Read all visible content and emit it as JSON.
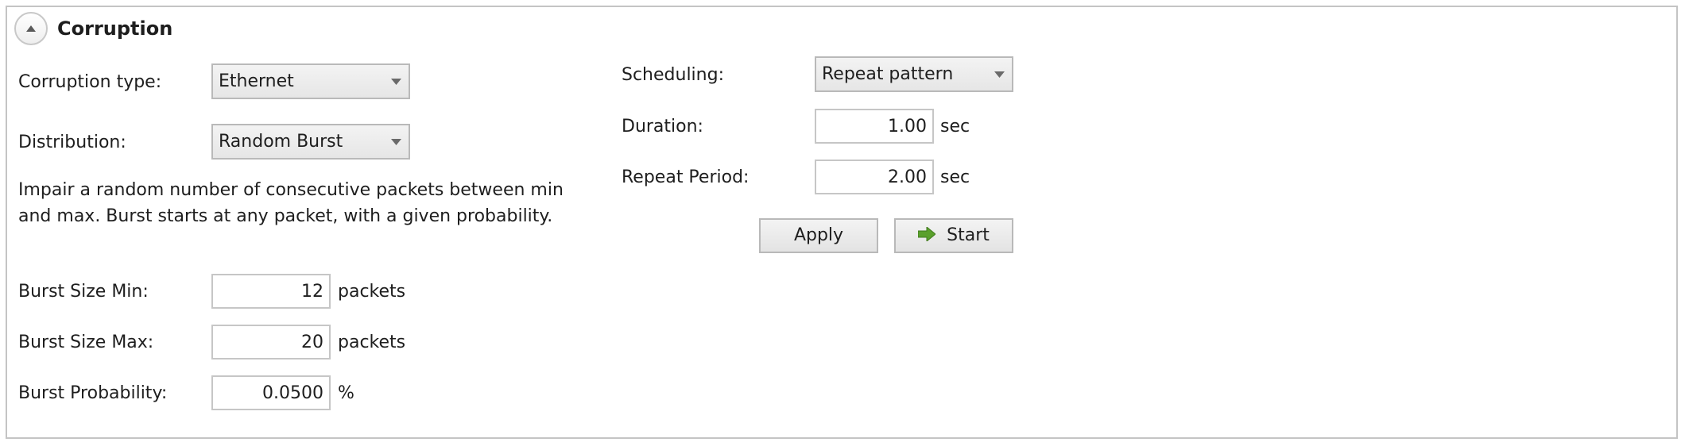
{
  "section": {
    "title": "Corruption",
    "collapse_icon": "chevron-up-icon"
  },
  "left": {
    "corruption_type": {
      "label": "Corruption type:",
      "value": "Ethernet"
    },
    "distribution": {
      "label": "Distribution:",
      "value": "Random Burst"
    },
    "description": "Impair a random number of consecutive packets between min and max. Burst starts at any packet, with a given probability.",
    "burst_size_min": {
      "label": "Burst Size Min:",
      "value": "12",
      "unit": "packets"
    },
    "burst_size_max": {
      "label": "Burst Size Max:",
      "value": "20",
      "unit": "packets"
    },
    "burst_probability": {
      "label": "Burst Probability:",
      "value": "0.0500",
      "unit": "%"
    }
  },
  "right": {
    "scheduling": {
      "label": "Scheduling:",
      "value": "Repeat pattern"
    },
    "duration": {
      "label": "Duration:",
      "value": "1.00",
      "unit": "sec"
    },
    "repeat_period": {
      "label": "Repeat Period:",
      "value": "2.00",
      "unit": "sec"
    },
    "apply_label": "Apply",
    "start_label": "Start",
    "start_icon": "arrow-right-icon",
    "start_icon_color": "#5aa02c"
  }
}
